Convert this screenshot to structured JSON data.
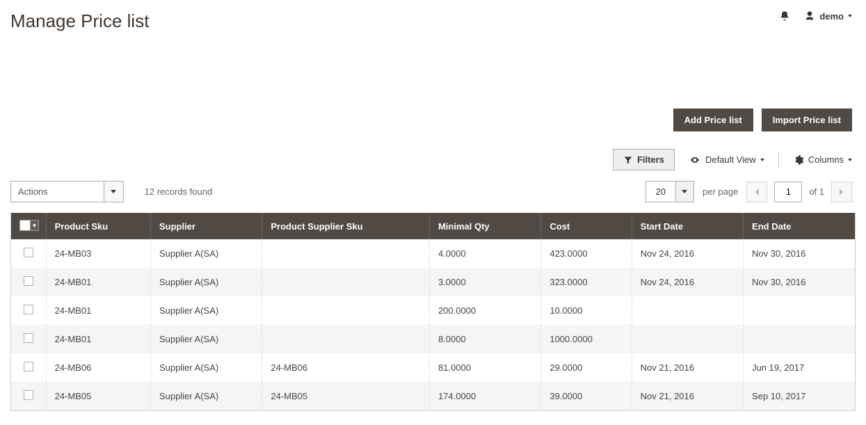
{
  "header": {
    "page_title": "Manage Price list",
    "user_name": "demo"
  },
  "actions": {
    "add_label": "Add Price list",
    "import_label": "Import Price list"
  },
  "toolbar": {
    "filters_label": "Filters",
    "default_view_label": "Default View",
    "columns_label": "Columns"
  },
  "controls": {
    "actions_label": "Actions",
    "records_found": "12 records found",
    "per_page_value": "20",
    "per_page_label": "per page",
    "current_page": "1",
    "of_label": "of 1"
  },
  "table": {
    "columns": [
      "Product Sku",
      "Supplier",
      "Product Supplier Sku",
      "Minimal Qty",
      "Cost",
      "Start Date",
      "End Date"
    ],
    "rows": [
      {
        "sku": "24-MB03",
        "supplier": "Supplier A(SA)",
        "psku": "",
        "minqty": "4.0000",
        "cost": "423.0000",
        "start": "Nov 24, 2016",
        "end": "Nov 30, 2016"
      },
      {
        "sku": "24-MB01",
        "supplier": "Supplier A(SA)",
        "psku": "",
        "minqty": "3.0000",
        "cost": "323.0000",
        "start": "Nov 24, 2016",
        "end": "Nov 30, 2016"
      },
      {
        "sku": "24-MB01",
        "supplier": "Supplier A(SA)",
        "psku": "",
        "minqty": "200.0000",
        "cost": "10.0000",
        "start": "",
        "end": ""
      },
      {
        "sku": "24-MB01",
        "supplier": "Supplier A(SA)",
        "psku": "",
        "minqty": "8.0000",
        "cost": "1000.0000",
        "start": "",
        "end": ""
      },
      {
        "sku": "24-MB06",
        "supplier": "Supplier A(SA)",
        "psku": "24-MB06",
        "minqty": "81.0000",
        "cost": "29.0000",
        "start": "Nov 21, 2016",
        "end": "Jun 19, 2017"
      },
      {
        "sku": "24-MB05",
        "supplier": "Supplier A(SA)",
        "psku": "24-MB05",
        "minqty": "174.0000",
        "cost": "39.0000",
        "start": "Nov 21, 2016",
        "end": "Sep 10, 2017"
      }
    ]
  }
}
